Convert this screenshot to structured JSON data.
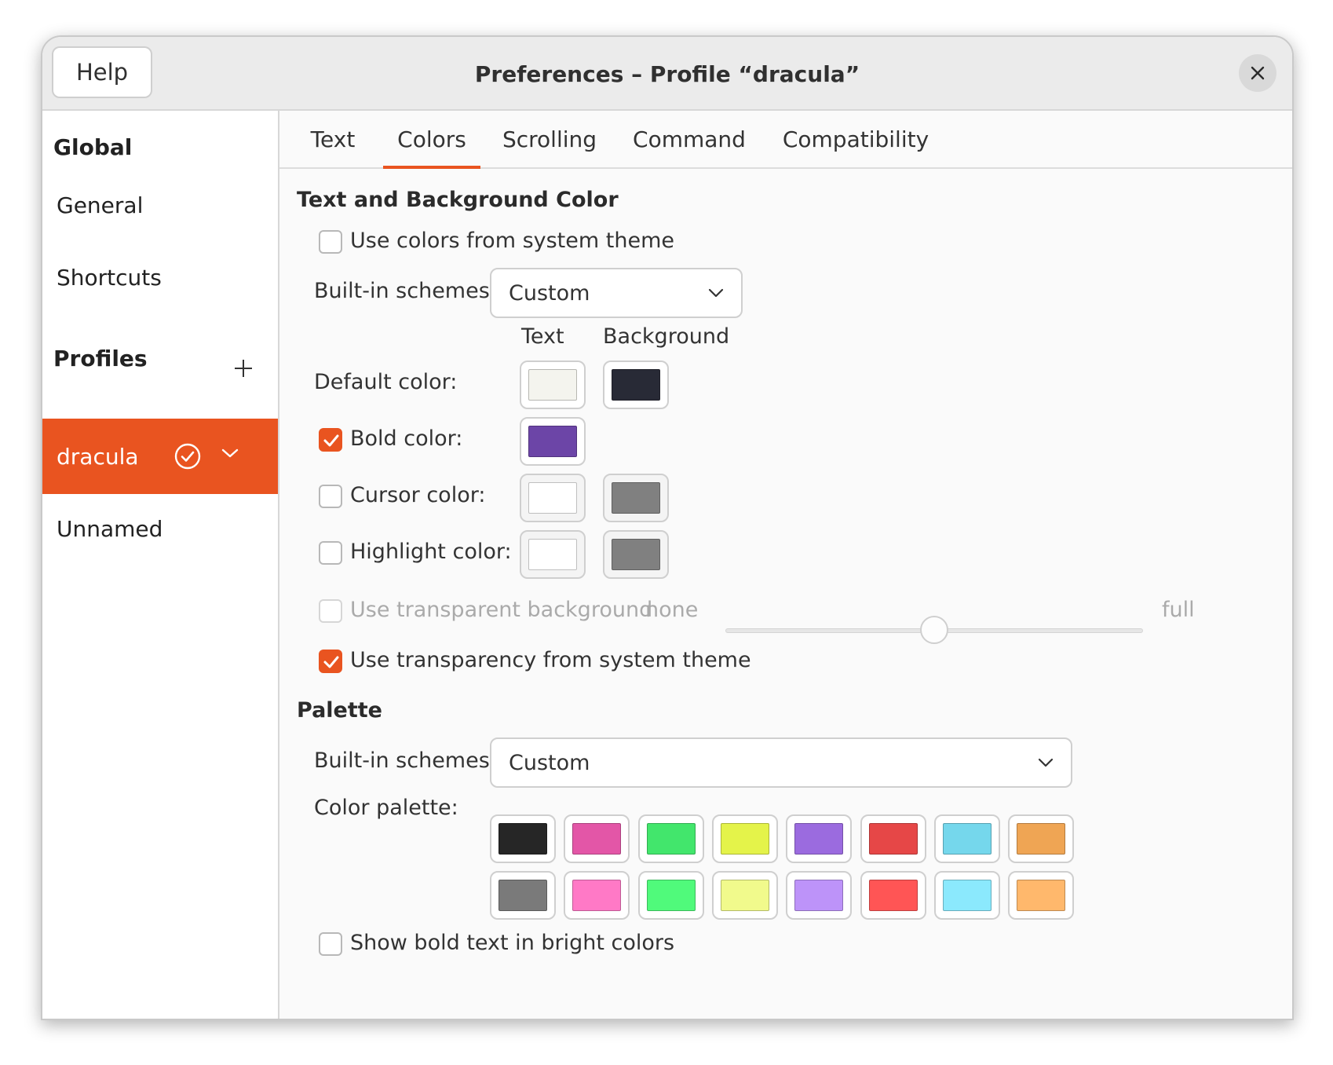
{
  "window": {
    "title": "Preferences – Profile “dracula”"
  },
  "titlebar": {
    "help_label": "Help"
  },
  "sidebar": {
    "global_header": "Global",
    "general": "General",
    "shortcuts": "Shortcuts",
    "profiles_header": "Profiles",
    "profiles": [
      {
        "name": "dracula",
        "selected": true
      },
      {
        "name": "Unnamed",
        "selected": false
      }
    ]
  },
  "tabs": [
    "Text",
    "Colors",
    "Scrolling",
    "Command",
    "Compatibility"
  ],
  "active_tab": "Colors",
  "text_bg": {
    "section_title": "Text and Background Color",
    "use_system_colors": {
      "label": "Use colors from system theme",
      "checked": false
    },
    "builtin_label": "Built-in schemes:",
    "builtin_value": "Custom",
    "col_text": "Text",
    "col_background": "Background",
    "default_color": {
      "label": "Default color:",
      "text": "#f4f4ee",
      "background": "#282a36"
    },
    "bold_color": {
      "label": "Bold color:",
      "checked": true,
      "text": "#6c45a7"
    },
    "cursor_color": {
      "label": "Cursor color:",
      "checked": false,
      "text": "#ffffff",
      "background": "#808080"
    },
    "highlight_color": {
      "label": "Highlight color:",
      "checked": false,
      "text": "#ffffff",
      "background": "#808080"
    },
    "transparent_bg": {
      "label": "Use transparent background",
      "checked": false,
      "min_label": "none",
      "max_label": "full",
      "value": 0.5
    },
    "transparency_system": {
      "label": "Use transparency from system theme",
      "checked": true
    }
  },
  "palette": {
    "section_title": "Palette",
    "builtin_label": "Built-in schemes:",
    "builtin_value": "Custom",
    "palette_label": "Color palette:",
    "row1": [
      "#262626",
      "#e356a7",
      "#42e66c",
      "#e4f34a",
      "#9b6bdf",
      "#e64747",
      "#75d7ec",
      "#efa554"
    ],
    "row2": [
      "#7a7a7a",
      "#ff79c6",
      "#50fa7b",
      "#f1fa8c",
      "#bd93f9",
      "#ff5555",
      "#8be9fd",
      "#ffb86c"
    ],
    "bold_bright": {
      "label": "Show bold text in bright colors",
      "checked": false
    }
  },
  "colors": {
    "accent": "#e95420"
  }
}
